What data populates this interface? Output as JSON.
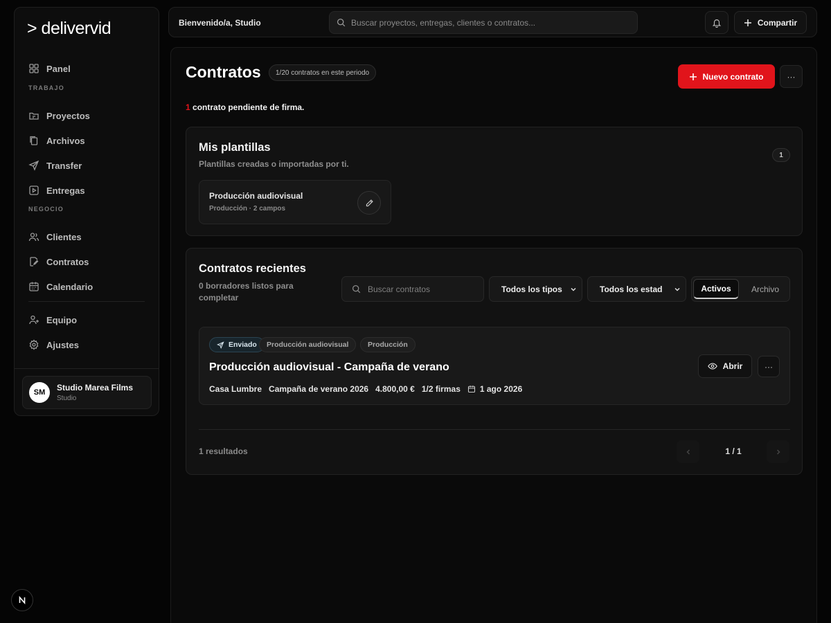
{
  "brand": {
    "logo_text": "> delivervid"
  },
  "sidebar": {
    "items_top": [
      {
        "label": "Panel",
        "icon": "dashboard-icon"
      }
    ],
    "section_work": "TRABAJO",
    "items_work": [
      {
        "label": "Proyectos",
        "icon": "folder-icon"
      },
      {
        "label": "Archivos",
        "icon": "files-icon"
      },
      {
        "label": "Transfer",
        "icon": "send-icon"
      },
      {
        "label": "Entregas",
        "icon": "play-square-icon"
      }
    ],
    "section_business": "NEGOCIO",
    "items_business": [
      {
        "label": "Clientes",
        "icon": "users-icon"
      },
      {
        "label": "Contratos",
        "icon": "contract-icon"
      },
      {
        "label": "Calendario",
        "icon": "calendar-icon"
      }
    ],
    "items_bottom": [
      {
        "label": "Equipo",
        "icon": "user-plus-icon"
      },
      {
        "label": "Ajustes",
        "icon": "gear-icon"
      }
    ],
    "account": {
      "initials": "SM",
      "name": "Studio Marea Films",
      "role": "Studio"
    }
  },
  "topbar": {
    "welcome": "Bienvenido/a, Studio",
    "search_placeholder": "Buscar proyectos, entregas, clientes o contratos...",
    "share_label": "Compartir"
  },
  "page": {
    "title": "Contratos",
    "period_badge": "1/20 contratos en este periodo",
    "new_button": "Nuevo contrato",
    "more_button": "···",
    "pending_count": "1",
    "pending_text": " contrato pendiente de firma."
  },
  "templates": {
    "title": "Mis plantillas",
    "subtitle": "Plantillas creadas o importadas por ti.",
    "count": "1",
    "items": [
      {
        "name": "Producción audiovisual",
        "meta": "Producción · 2 campos"
      }
    ]
  },
  "recent": {
    "title": "Contratos recientes",
    "subtitle": "0 borradores listos para completar",
    "search_placeholder": "Buscar contratos",
    "type_filter": "Todos los tipos",
    "status_filter": "Todos los estad",
    "segment_active": "Activos",
    "segment_inactive": "Archivo",
    "contracts": [
      {
        "status": "Enviado",
        "tags": [
          "Producción audiovisual",
          "Producción"
        ],
        "title": "Producción audiovisual - Campaña de verano",
        "client": "Casa Lumbre",
        "project": "Campaña de verano 2026",
        "amount": "4.800,00 €",
        "signatures": "1/2 firmas",
        "date": "1 ago 2026",
        "open_label": "Abrir",
        "more_label": "···"
      }
    ],
    "results_text": "1 resultados",
    "page_label": "1 / 1"
  },
  "colors": {
    "accent": "#e1141b",
    "background": "#050505",
    "card": "#121212"
  }
}
